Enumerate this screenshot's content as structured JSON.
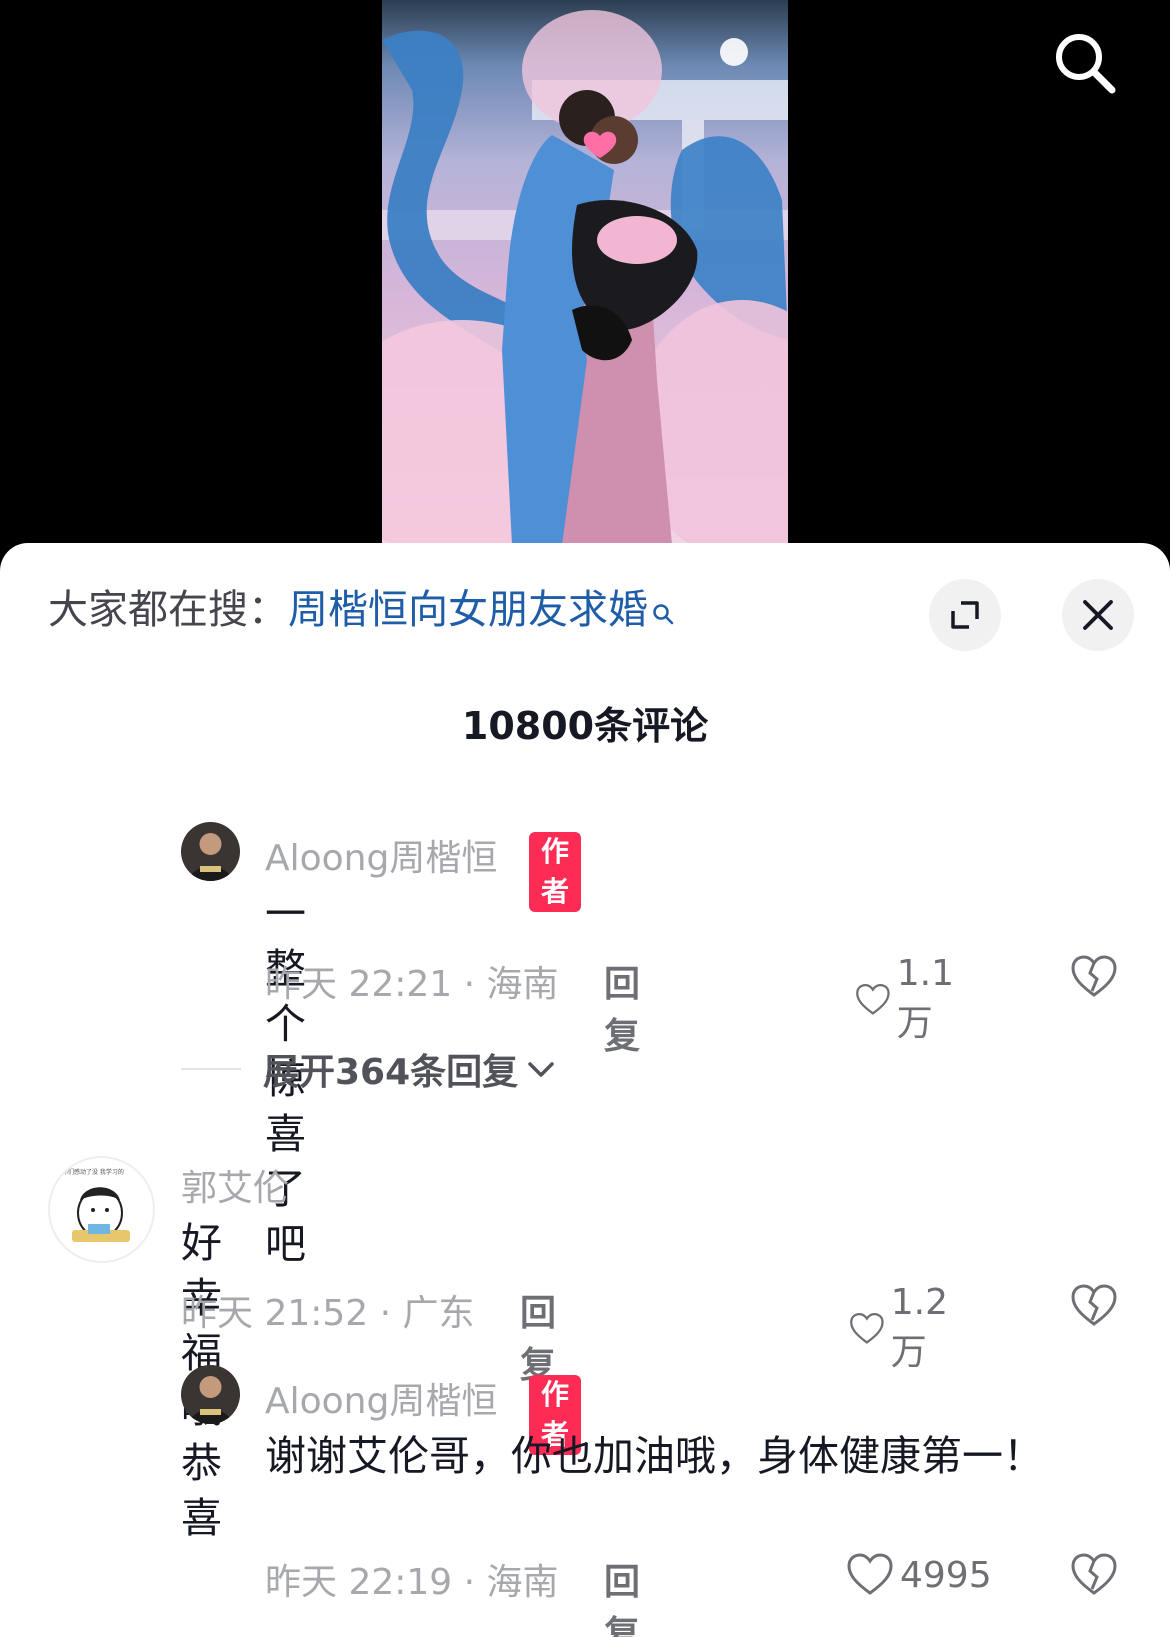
{
  "hot_search": {
    "prefix": "大家都在搜：",
    "query": "周楷恒向女朋友求婚"
  },
  "comments_header": {
    "count_label": "10800条评论"
  },
  "comments": [
    {
      "author": "Aloong周楷恒",
      "badge": "作者",
      "text": "一整个惊喜了吧",
      "meta": "昨天 22:21 · 海南",
      "reply": "回复",
      "likes": "1.1万"
    },
    {
      "expand_label": "展开364条回复"
    },
    {
      "author": "郭艾伦",
      "text": "好幸福哦 恭喜",
      "meta": "昨天 21:52 · 广东",
      "reply": "回复",
      "likes": "1.2万"
    },
    {
      "author": "Aloong周楷恒",
      "badge": "作者",
      "text": "谢谢艾伦哥，你也加油哦，身体健康第一！",
      "meta": "昨天 22:19 · 海南",
      "reply": "回复",
      "likes": "4995"
    }
  ],
  "avatar_note": "你们感动了没 我学习的",
  "icons": {
    "search": "search-icon",
    "expand": "expand-icon",
    "close": "close-icon",
    "like": "heart-icon",
    "dislike": "broken-heart-icon",
    "chevron": "chevron-down-icon"
  },
  "colors": {
    "brand_red": "#fe2c55",
    "link_blue": "#1f5da8"
  }
}
